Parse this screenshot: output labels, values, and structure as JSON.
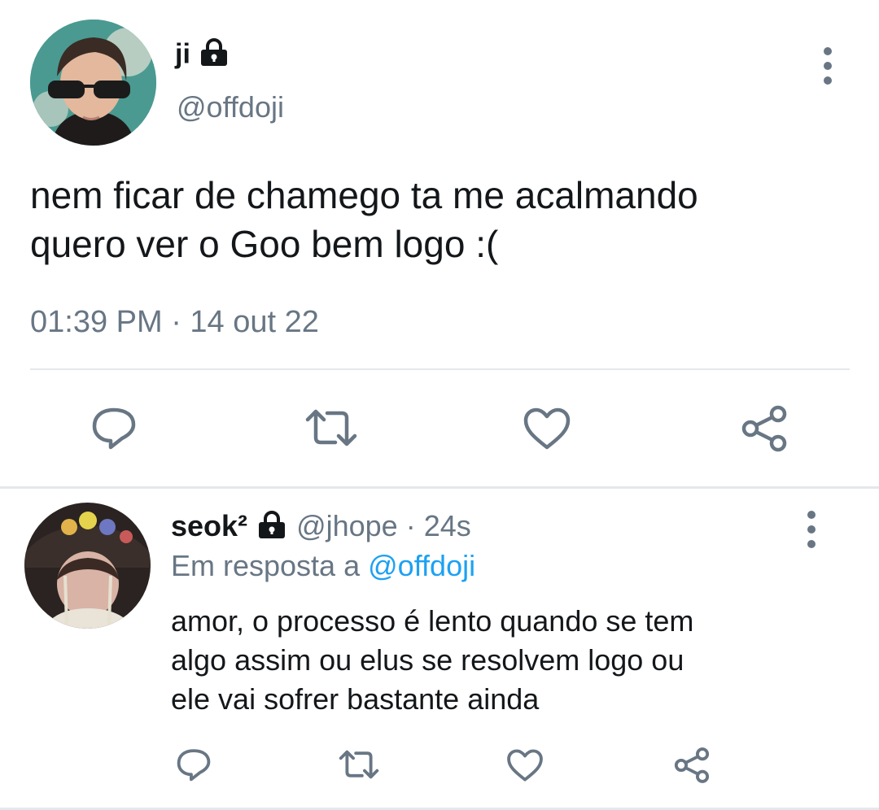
{
  "main_tweet": {
    "display_name": "ji",
    "handle": "@offdoji",
    "text_line1": "nem ficar de chamego ta me acalmando",
    "text_line2": "quero ver o Goo bem logo :(",
    "timestamp": "01:39 PM · 14 out 22",
    "avatar_description": "profile photo"
  },
  "reply": {
    "display_name": "seok²",
    "handle": "@jhope",
    "separator": "·",
    "time": "24s",
    "replying_to_label": "Em resposta a",
    "replying_to_handle": "@offdoji",
    "text_line1": "amor, o processo é lento quando se tem",
    "text_line2": "algo assim ou elus se resolvem logo ou",
    "text_line3": "ele vai sofrer bastante ainda"
  },
  "icons": [
    "lock-icon",
    "more-options-icon",
    "reply-icon",
    "retweet-icon",
    "like-icon",
    "share-icon"
  ],
  "colors": {
    "text": "#14171a",
    "secondary": "#687684",
    "link": "#1da1f2",
    "divider": "#e4e8ec"
  }
}
